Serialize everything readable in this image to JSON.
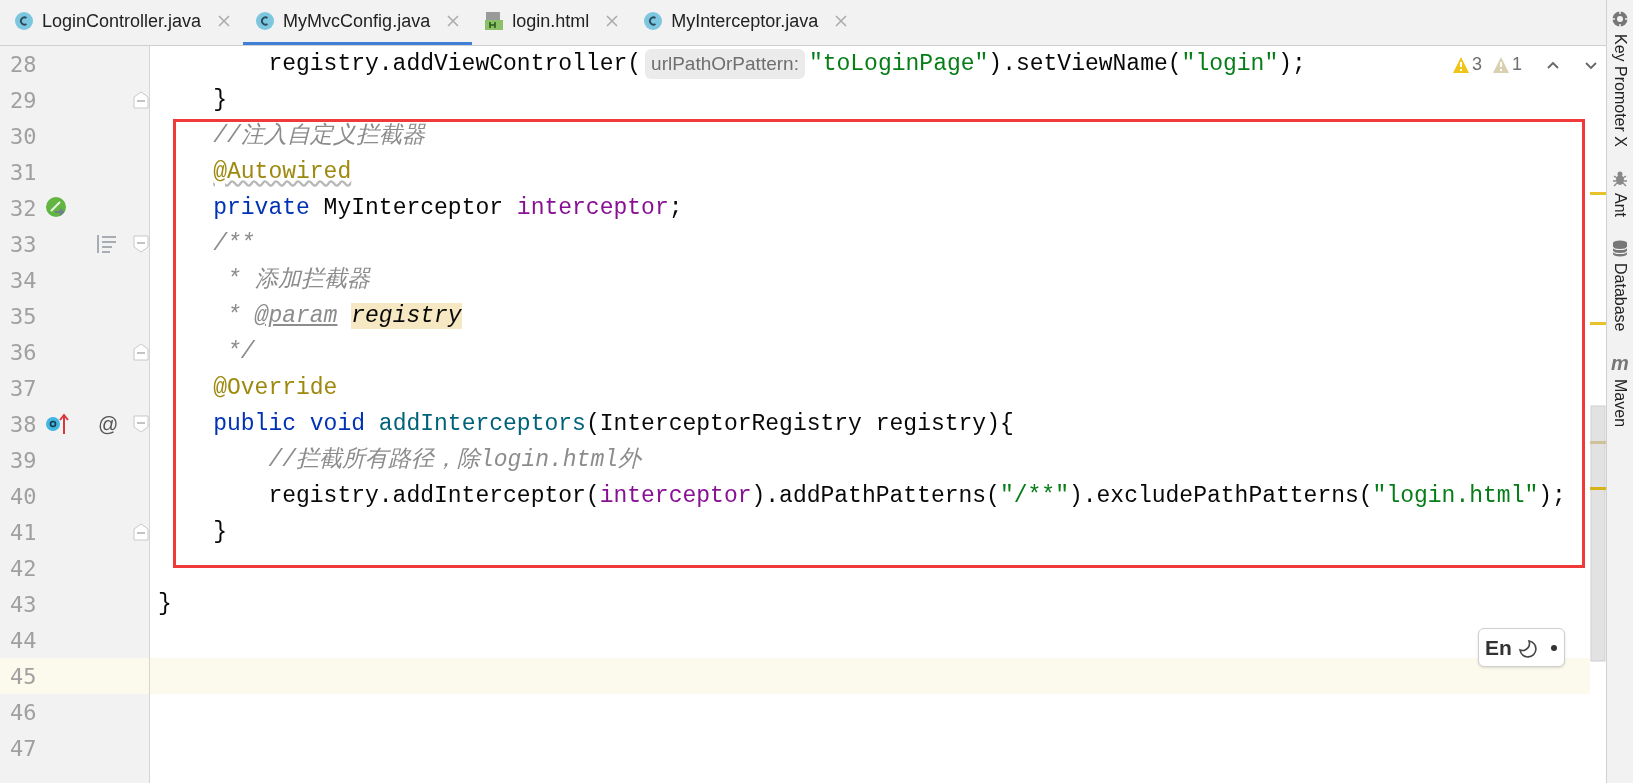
{
  "tabs": [
    {
      "label": "LoginController.java",
      "kind": "class",
      "selected": false
    },
    {
      "label": "MyMvcConfig.java",
      "kind": "class",
      "selected": true
    },
    {
      "label": "login.html",
      "kind": "html",
      "selected": false
    },
    {
      "label": "MyInterceptor.java",
      "kind": "class",
      "selected": false
    }
  ],
  "inspections": {
    "warnings": "3",
    "weak_warnings": "1"
  },
  "lines": [
    {
      "number": "28",
      "current": false,
      "tokens": [
        {
          "text": "        registry.addViewController(",
          "kind": "plain"
        },
        {
          "text": "urlPathOrPattern:",
          "kind": "hint"
        },
        {
          "text": "\"toLoginPage\"",
          "kind": "string"
        },
        {
          "text": ").setViewName(",
          "kind": "plain"
        },
        {
          "text": "\"login\"",
          "kind": "string"
        },
        {
          "text": ");",
          "kind": "plain"
        }
      ]
    },
    {
      "number": "29",
      "current": false,
      "gutter": [
        {
          "kind": "fold-end"
        }
      ],
      "tokens": [
        {
          "text": "    }",
          "kind": "plain"
        }
      ]
    },
    {
      "number": "30",
      "current": false,
      "tokens": [
        {
          "text": "    //注入自定义拦截器",
          "kind": "comment"
        }
      ]
    },
    {
      "number": "31",
      "current": false,
      "tokens": [
        {
          "text": "    @Autowired",
          "kind": "annotation-warning"
        }
      ]
    },
    {
      "number": "32",
      "current": false,
      "gutter": [
        {
          "kind": "bean"
        }
      ],
      "tokens": [
        {
          "text": "    private",
          "kind": "keyword"
        },
        {
          "text": " MyInterceptor ",
          "kind": "plain"
        },
        {
          "text": "interceptor",
          "kind": "field"
        },
        {
          "text": ";",
          "kind": "plain"
        }
      ]
    },
    {
      "number": "33",
      "current": false,
      "gutter": [
        {
          "kind": "doc-toggle"
        },
        {
          "kind": "fold-start"
        }
      ],
      "tokens": [
        {
          "text": "    /**",
          "kind": "comment"
        }
      ]
    },
    {
      "number": "34",
      "current": false,
      "tokens": [
        {
          "text": "     * 添加拦截器",
          "kind": "comment"
        }
      ]
    },
    {
      "number": "35",
      "current": false,
      "tokens": [
        {
          "text": "     * ",
          "kind": "comment"
        },
        {
          "text": "@param",
          "kind": "doc-tag"
        },
        {
          "text": "registry",
          "kind": "param-highlight"
        }
      ]
    },
    {
      "number": "36",
      "current": false,
      "gutter": [
        {
          "kind": "fold-end"
        }
      ],
      "tokens": [
        {
          "text": "     */",
          "kind": "comment"
        }
      ]
    },
    {
      "number": "37",
      "current": false,
      "tokens": [
        {
          "text": "    @Override",
          "kind": "annotation"
        }
      ]
    },
    {
      "number": "38",
      "current": false,
      "gutter": [
        {
          "kind": "override"
        },
        {
          "kind": "text",
          "text": "@"
        },
        {
          "kind": "fold-start"
        }
      ],
      "tokens": [
        {
          "text": "    public void ",
          "kind": "keyword"
        },
        {
          "text": "addInterceptors",
          "kind": "method"
        },
        {
          "text": "(InterceptorRegistry registry){",
          "kind": "plain"
        }
      ]
    },
    {
      "number": "39",
      "current": false,
      "tokens": [
        {
          "text": "        //拦截所有路径，除login.html外",
          "kind": "comment"
        }
      ]
    },
    {
      "number": "40",
      "current": false,
      "tokens": [
        {
          "text": "        registry.addInterceptor(",
          "kind": "plain"
        },
        {
          "text": "interceptor",
          "kind": "field"
        },
        {
          "text": ").addPathPatterns(",
          "kind": "plain"
        },
        {
          "text": "\"/**\"",
          "kind": "string"
        },
        {
          "text": ").excludePathPatterns(",
          "kind": "plain"
        },
        {
          "text": "\"login.html\"",
          "kind": "string"
        },
        {
          "text": ");",
          "kind": "plain"
        }
      ]
    },
    {
      "number": "41",
      "current": false,
      "gutter": [
        {
          "kind": "fold-end"
        }
      ],
      "tokens": [
        {
          "text": "    }",
          "kind": "plain"
        }
      ]
    },
    {
      "number": "42",
      "current": false
    },
    {
      "number": "43",
      "current": false,
      "tokens": [
        {
          "text": "}",
          "kind": "plain"
        }
      ]
    },
    {
      "number": "44",
      "current": false
    },
    {
      "number": "45",
      "current": true
    },
    {
      "number": "46",
      "current": false
    },
    {
      "number": "47",
      "current": false
    }
  ],
  "ime": {
    "label": "En"
  },
  "tool_windows": [
    {
      "label": "Key Promoter X",
      "kind": "gear"
    },
    {
      "label": "Ant",
      "kind": "bug"
    },
    {
      "label": "Database",
      "kind": "database"
    },
    {
      "label": "Maven",
      "kind": "glyph",
      "glyph": "m"
    }
  ]
}
